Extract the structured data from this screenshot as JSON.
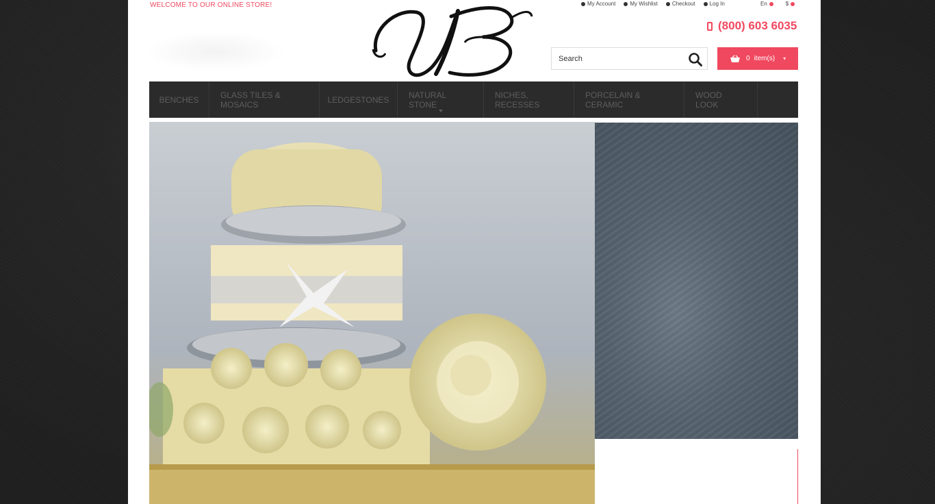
{
  "header": {
    "welcome": "WELCOME TO OUR ONLINE STORE!",
    "links": [
      {
        "label": "My Account",
        "name": "my-account-link"
      },
      {
        "label": "My Wishlist",
        "name": "my-wishlist-link"
      },
      {
        "label": "Checkout",
        "name": "checkout-link"
      },
      {
        "label": "Log In",
        "name": "log-in-link"
      }
    ],
    "language": "En",
    "currency": "$",
    "phone": "(800) 603 6035",
    "logo_text": "UB"
  },
  "search": {
    "placeholder": "Search"
  },
  "cart": {
    "count": "0",
    "label": "item(s)"
  },
  "nav": {
    "items": [
      "BENCHES",
      "GLASS TILES & MOSAICS",
      "LEDGESTONES",
      "NATURAL STONE",
      "NICHES, RECESSES",
      "PORCELAIN & CERAMIC",
      "WOOD LOOK"
    ]
  },
  "colors": {
    "accent": "#f0485f",
    "nav_bg": "#2b2b2b",
    "background": "#1f1f1f"
  }
}
